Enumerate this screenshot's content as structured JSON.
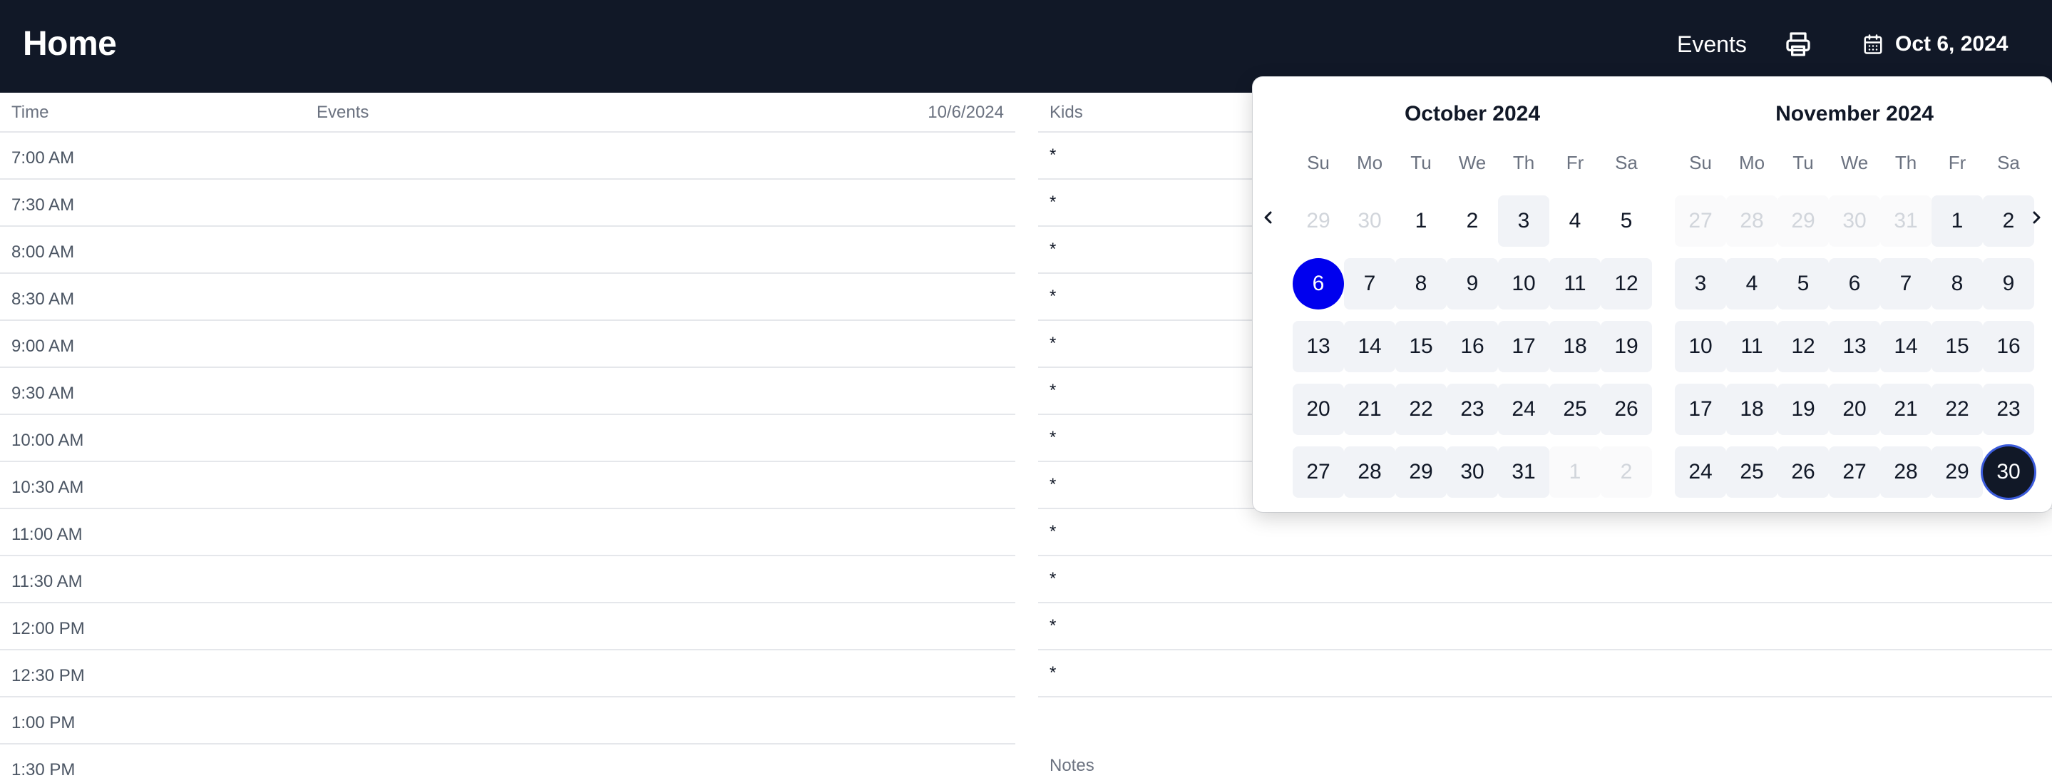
{
  "header": {
    "title": "Home",
    "events_link": "Events",
    "date_label": "Oct 6, 2024",
    "print_icon": "printer-icon",
    "calendar_icon": "calendar-icon"
  },
  "schedule": {
    "col_time": "Time",
    "col_events": "Events",
    "date": "10/6/2024",
    "times": [
      "7:00 AM",
      "7:30 AM",
      "8:00 AM",
      "8:30 AM",
      "9:00 AM",
      "9:30 AM",
      "10:00 AM",
      "10:30 AM",
      "11:00 AM",
      "11:30 AM",
      "12:00 PM",
      "12:30 PM",
      "1:00 PM",
      "1:30 PM"
    ]
  },
  "kids": {
    "heading": "Kids",
    "marks": [
      "*",
      "*",
      "*",
      "*",
      "*",
      "*",
      "*",
      "*",
      "*",
      "*",
      "*",
      "*"
    ],
    "notes_label": "Notes"
  },
  "calendar": {
    "weekdays": [
      "Su",
      "Mo",
      "Tu",
      "We",
      "Th",
      "Fr",
      "Sa"
    ],
    "prev_icon": "chevron-left-icon",
    "next_icon": "chevron-right-icon",
    "months": [
      {
        "caption": "October 2024",
        "days": [
          {
            "label": "29",
            "state": "outside"
          },
          {
            "label": "30",
            "state": "outside"
          },
          {
            "label": "1",
            "state": ""
          },
          {
            "label": "2",
            "state": ""
          },
          {
            "label": "3",
            "state": "filled"
          },
          {
            "label": "4",
            "state": ""
          },
          {
            "label": "5",
            "state": ""
          },
          {
            "label": "6",
            "state": "selected"
          },
          {
            "label": "7",
            "state": "filled"
          },
          {
            "label": "8",
            "state": "filled"
          },
          {
            "label": "9",
            "state": "filled"
          },
          {
            "label": "10",
            "state": "filled"
          },
          {
            "label": "11",
            "state": "filled"
          },
          {
            "label": "12",
            "state": "filled"
          },
          {
            "label": "13",
            "state": "filled"
          },
          {
            "label": "14",
            "state": "filled"
          },
          {
            "label": "15",
            "state": "filled"
          },
          {
            "label": "16",
            "state": "filled"
          },
          {
            "label": "17",
            "state": "filled"
          },
          {
            "label": "18",
            "state": "filled"
          },
          {
            "label": "19",
            "state": "filled"
          },
          {
            "label": "20",
            "state": "filled"
          },
          {
            "label": "21",
            "state": "filled"
          },
          {
            "label": "22",
            "state": "filled"
          },
          {
            "label": "23",
            "state": "filled"
          },
          {
            "label": "24",
            "state": "filled"
          },
          {
            "label": "25",
            "state": "filled"
          },
          {
            "label": "26",
            "state": "filled"
          },
          {
            "label": "27",
            "state": "filled"
          },
          {
            "label": "28",
            "state": "filled"
          },
          {
            "label": "29",
            "state": "filled"
          },
          {
            "label": "30",
            "state": "filled"
          },
          {
            "label": "31",
            "state": "filled"
          },
          {
            "label": "1",
            "state": "outside filled"
          },
          {
            "label": "2",
            "state": "outside filled"
          }
        ]
      },
      {
        "caption": "November 2024",
        "days": [
          {
            "label": "27",
            "state": "outside filled"
          },
          {
            "label": "28",
            "state": "outside filled"
          },
          {
            "label": "29",
            "state": "outside filled"
          },
          {
            "label": "30",
            "state": "outside filled"
          },
          {
            "label": "31",
            "state": "outside filled"
          },
          {
            "label": "1",
            "state": "filled"
          },
          {
            "label": "2",
            "state": "filled"
          },
          {
            "label": "3",
            "state": "filled"
          },
          {
            "label": "4",
            "state": "filled"
          },
          {
            "label": "5",
            "state": "filled"
          },
          {
            "label": "6",
            "state": "filled"
          },
          {
            "label": "7",
            "state": "filled"
          },
          {
            "label": "8",
            "state": "filled"
          },
          {
            "label": "9",
            "state": "filled"
          },
          {
            "label": "10",
            "state": "filled"
          },
          {
            "label": "11",
            "state": "filled"
          },
          {
            "label": "12",
            "state": "filled"
          },
          {
            "label": "13",
            "state": "filled"
          },
          {
            "label": "14",
            "state": "filled"
          },
          {
            "label": "15",
            "state": "filled"
          },
          {
            "label": "16",
            "state": "filled"
          },
          {
            "label": "17",
            "state": "filled"
          },
          {
            "label": "18",
            "state": "filled"
          },
          {
            "label": "19",
            "state": "filled"
          },
          {
            "label": "20",
            "state": "filled"
          },
          {
            "label": "21",
            "state": "filled"
          },
          {
            "label": "22",
            "state": "filled"
          },
          {
            "label": "23",
            "state": "filled"
          },
          {
            "label": "24",
            "state": "filled"
          },
          {
            "label": "25",
            "state": "filled"
          },
          {
            "label": "26",
            "state": "filled"
          },
          {
            "label": "27",
            "state": "filled"
          },
          {
            "label": "28",
            "state": "filled"
          },
          {
            "label": "29",
            "state": "filled"
          },
          {
            "label": "30",
            "state": "range-end"
          }
        ]
      }
    ]
  },
  "colors": {
    "header_bg": "#111827",
    "selected_day": "#0000ee",
    "range_end": "#111827",
    "range_fill": "#f1f3f7"
  }
}
